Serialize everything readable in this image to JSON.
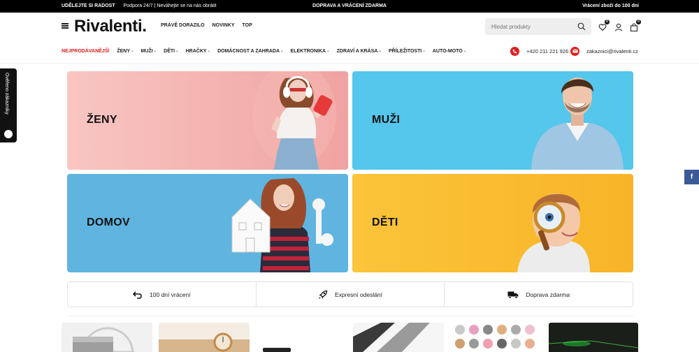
{
  "topbar": {
    "left_bold": "UDĚLEJTE SI RADOST",
    "left_sub": "Podpora 24/7 | Neváhejte se na nás obrátit",
    "center": "DOPRAVA A VRÁCENÍ ZDARMA",
    "right": "Vrácení zboží do 100 dní"
  },
  "header": {
    "logo": "Rivalenti.",
    "nav": [
      "PRÁVĚ DORAZILO",
      "NOVINKY",
      "TOP"
    ],
    "search_placeholder": "Hledat produkty",
    "wishlist_count": "0",
    "cart_count": "0"
  },
  "catnav": [
    {
      "label": "NEJPRODÁVANĚJŠÍ",
      "hot": true,
      "caret": false
    },
    {
      "label": "ŽENY",
      "hot": false,
      "caret": true
    },
    {
      "label": "MUŽI",
      "hot": false,
      "caret": true
    },
    {
      "label": "DĚTI",
      "hot": false,
      "caret": true
    },
    {
      "label": "HRAČKY",
      "hot": false,
      "caret": true
    },
    {
      "label": "DOMÁCNOST A ZAHRADA",
      "hot": false,
      "caret": true
    },
    {
      "label": "ELEKTRONIKA",
      "hot": false,
      "caret": true
    },
    {
      "label": "ZDRAVÍ A KRÁSA",
      "hot": false,
      "caret": true
    },
    {
      "label": "PŘÍLEŽITOSTI",
      "hot": false,
      "caret": true
    },
    {
      "label": "AUTO-MOTO",
      "hot": false,
      "caret": true
    }
  ],
  "contact": {
    "phone": "+420 211 221 926",
    "email": "zakaznici@rivalenti.cz"
  },
  "side": {
    "review_tab": "Ověřeno zákazníky",
    "facebook": "f"
  },
  "banners": {
    "zeny": "ŽENY",
    "muzi": "MUŽI",
    "domov": "DOMOV",
    "deti": "DĚTI"
  },
  "benefits": [
    {
      "label": "100 dní vrácení",
      "icon": "return-arrow-icon"
    },
    {
      "label": "Expresní odeslání",
      "icon": "rocket-icon"
    },
    {
      "label": "Doprava zdarma",
      "icon": "truck-icon"
    }
  ],
  "colors": {
    "accent": "#e02020",
    "zeny_bg": "#f3b0ad",
    "muzi_bg": "#55c6ec",
    "domov_bg": "#5fb5e0",
    "deti_bg": "#f9bc30",
    "facebook": "#3b5998"
  }
}
